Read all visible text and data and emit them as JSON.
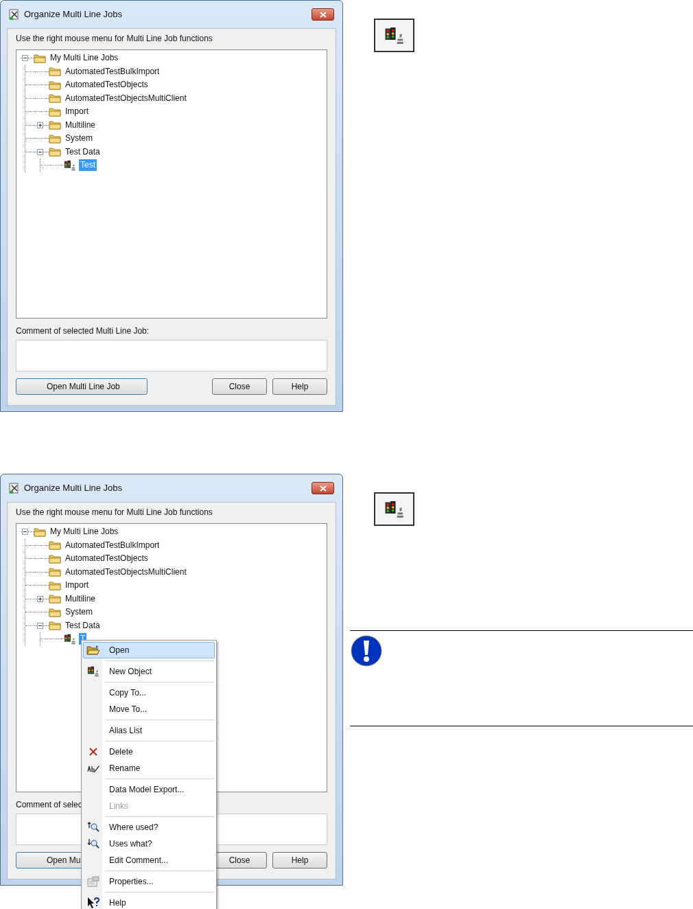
{
  "dialogs": [
    {
      "title": "Organize Multi Line Jobs",
      "instruction": "Use the right mouse menu for Multi Line Job functions",
      "tree": {
        "label": "My Multi Line Jobs",
        "kind": "folder",
        "expanded": true,
        "selected": false,
        "children": [
          {
            "label": "AutomatedTestBulkImport",
            "kind": "folder",
            "selected": false
          },
          {
            "label": "AutomatedTestObjects",
            "kind": "folder",
            "selected": false
          },
          {
            "label": "AutomatedTestObjectsMultiClient",
            "kind": "folder",
            "selected": false
          },
          {
            "label": "Import",
            "kind": "folder",
            "selected": false
          },
          {
            "label": "Multiline",
            "kind": "folder",
            "expanded": false,
            "selected": false
          },
          {
            "label": "System",
            "kind": "folder",
            "selected": false
          },
          {
            "label": "Test Data",
            "kind": "folder",
            "expanded": true,
            "selected": false,
            "children": [
              {
                "label": "Test",
                "kind": "job",
                "selected": true
              }
            ]
          }
        ]
      },
      "comment_label": "Comment of selected Multi Line Job:",
      "buttons": [
        {
          "label": "Open Multi Line Job",
          "default": true
        },
        {
          "label": "Close",
          "default": false
        },
        {
          "label": "Help",
          "default": false
        }
      ]
    },
    {
      "title": "Organize Multi Line Jobs",
      "instruction": "Use the right mouse menu for Multi Line Job functions",
      "tree": {
        "label": "My Multi Line Jobs",
        "kind": "folder",
        "expanded": true,
        "selected": false,
        "children": [
          {
            "label": "AutomatedTestBulkImport",
            "kind": "folder",
            "selected": false
          },
          {
            "label": "AutomatedTestObjects",
            "kind": "folder",
            "selected": false
          },
          {
            "label": "AutomatedTestObjectsMultiClient",
            "kind": "folder",
            "selected": false
          },
          {
            "label": "Import",
            "kind": "folder",
            "selected": false
          },
          {
            "label": "Multiline",
            "kind": "folder",
            "expanded": false,
            "selected": false
          },
          {
            "label": "System",
            "kind": "folder",
            "selected": false
          },
          {
            "label": "Test Data",
            "kind": "folder",
            "expanded": true,
            "selected": false,
            "children": [
              {
                "label": "T",
                "kind": "job",
                "selected": true
              }
            ]
          }
        ]
      },
      "comment_label": "Comment of selec",
      "buttons": [
        {
          "label": "Open Mul",
          "default": true
        },
        {
          "label": "Close",
          "default": false
        },
        {
          "label": "Help",
          "default": false
        }
      ]
    }
  ],
  "context_menu": {
    "groups": [
      [
        {
          "label": "Open",
          "highlighted": true,
          "disabled": false
        }
      ],
      [
        {
          "label": "New Object",
          "highlighted": false,
          "disabled": false
        }
      ],
      [
        {
          "label": "Copy To...",
          "highlighted": false,
          "disabled": false
        },
        {
          "label": "Move To...",
          "highlighted": false,
          "disabled": false
        }
      ],
      [
        {
          "label": "Alias List",
          "highlighted": false,
          "disabled": false
        }
      ],
      [
        {
          "label": "Delete",
          "highlighted": false,
          "disabled": false
        },
        {
          "label": "Rename",
          "highlighted": false,
          "disabled": false
        }
      ],
      [
        {
          "label": "Data Model Export...",
          "highlighted": false,
          "disabled": false
        },
        {
          "label": "Links",
          "highlighted": false,
          "disabled": true
        }
      ],
      [
        {
          "label": "Where used?",
          "highlighted": false,
          "disabled": false
        },
        {
          "label": "Uses what?",
          "highlighted": false,
          "disabled": false
        },
        {
          "label": "Edit Comment...",
          "highlighted": false,
          "disabled": false
        }
      ],
      [
        {
          "label": "Properties...",
          "highlighted": false,
          "disabled": false
        }
      ],
      [
        {
          "label": "Help",
          "highlighted": false,
          "disabled": false
        }
      ]
    ]
  }
}
